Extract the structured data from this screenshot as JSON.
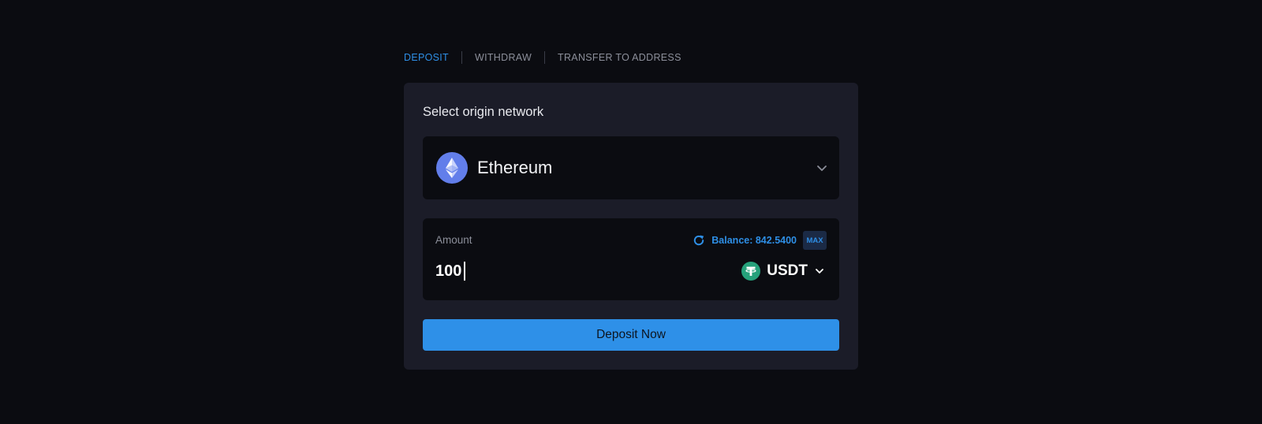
{
  "tabs": [
    {
      "label": "DEPOSIT",
      "active": true
    },
    {
      "label": "WITHDRAW",
      "active": false
    },
    {
      "label": "TRANSFER TO ADDRESS",
      "active": false
    }
  ],
  "card": {
    "title": "Select origin network",
    "network": {
      "name": "Ethereum",
      "icon": "ethereum-icon"
    },
    "amount": {
      "label": "Amount",
      "value": "100",
      "balance_text": "Balance: 842.5400",
      "max_label": "MAX",
      "token": {
        "symbol": "USDT",
        "icon": "tether-icon"
      }
    },
    "submit_label": "Deposit Now"
  },
  "colors": {
    "background": "#0b0c11",
    "card": "#1b1c28",
    "accent": "#2e8fe6",
    "ethereum": "#627eea",
    "tether": "#26a17b"
  }
}
